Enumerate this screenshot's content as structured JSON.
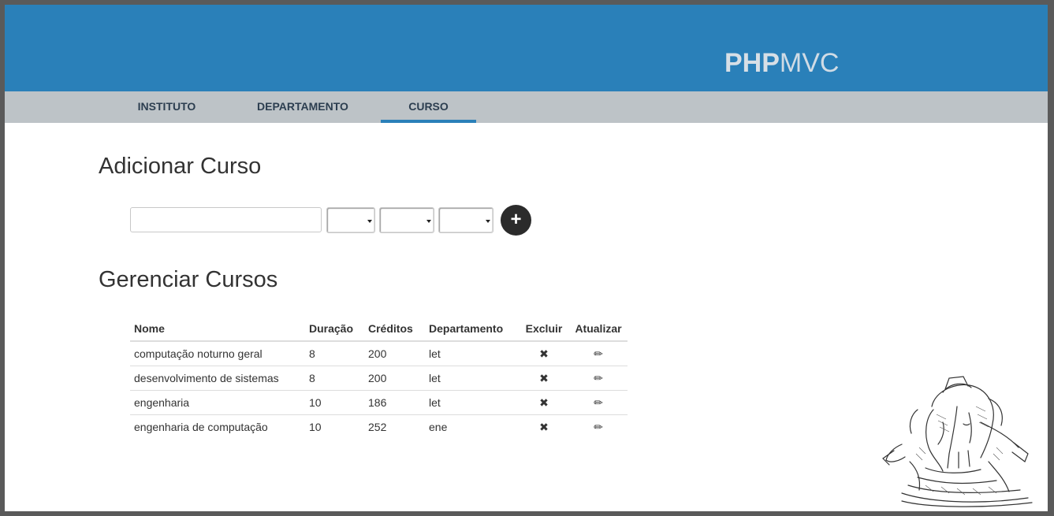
{
  "brand": {
    "bold": "PHP",
    "light": "MVC"
  },
  "nav": {
    "items": [
      {
        "label": "INSTITUTO"
      },
      {
        "label": "DEPARTAMENTO"
      },
      {
        "label": "CURSO"
      }
    ],
    "active": "CURSO"
  },
  "add_section": {
    "title": "Adicionar Curso",
    "name_input_value": "",
    "add_button_icon": "plus-icon",
    "add_button_label": "+"
  },
  "manage_section": {
    "title": "Gerenciar Cursos"
  },
  "table": {
    "headers": {
      "nome": "Nome",
      "duracao": "Duração",
      "creditos": "Créditos",
      "departamento": "Departamento",
      "excluir": "Excluir",
      "atualizar": "Atualizar"
    },
    "rows": [
      {
        "nome": "computação noturno geral",
        "duracao": "8",
        "creditos": "200",
        "departamento": "let"
      },
      {
        "nome": "desenvolvimento de sistemas",
        "duracao": "8",
        "creditos": "200",
        "departamento": "let"
      },
      {
        "nome": "engenharia",
        "duracao": "10",
        "creditos": "186",
        "departamento": "let"
      },
      {
        "nome": "engenharia de computação",
        "duracao": "10",
        "creditos": "252",
        "departamento": "ene"
      }
    ],
    "delete_icon": "✖",
    "edit_icon": "✏"
  },
  "colors": {
    "header": "#2a80b9",
    "navbar": "#bdc3c7",
    "active_tab_underline": "#2a80b9",
    "add_button": "#2b2b2b"
  }
}
